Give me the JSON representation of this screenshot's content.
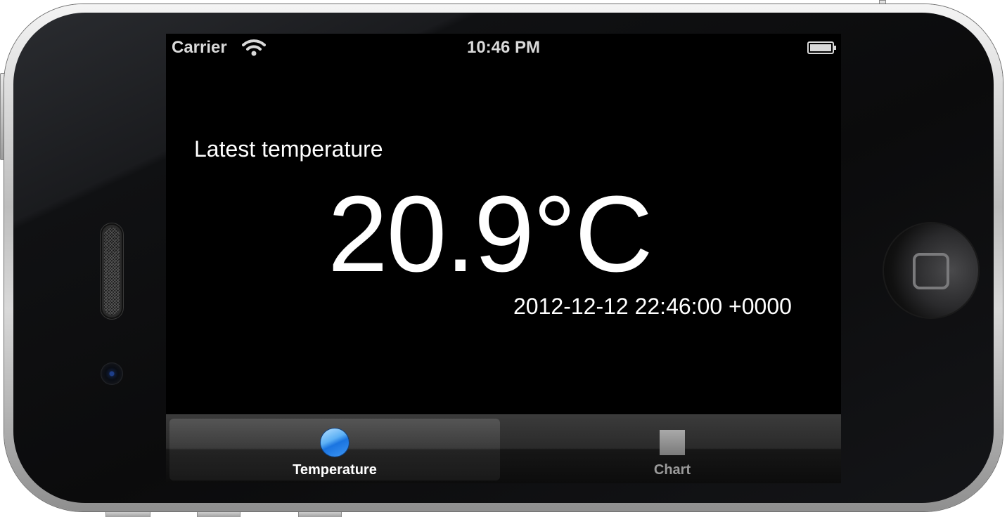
{
  "status_bar": {
    "carrier": "Carrier",
    "time": "10:46 PM",
    "wifi_icon": "wifi-icon",
    "battery_icon": "battery-full-icon"
  },
  "main": {
    "title": "Latest temperature",
    "temperature": "20.9°C",
    "timestamp": "2012-12-12 22:46:00 +0000"
  },
  "tab_bar": {
    "tabs": [
      {
        "label": "Temperature",
        "icon": "circle-icon",
        "selected": true
      },
      {
        "label": "Chart",
        "icon": "square-icon",
        "selected": false
      }
    ]
  },
  "colors": {
    "screen_background": "#000000",
    "text": "#ffffff",
    "selected_tab_icon": "#3d96f3",
    "unselected_tab_label": "#9b9b9b"
  }
}
